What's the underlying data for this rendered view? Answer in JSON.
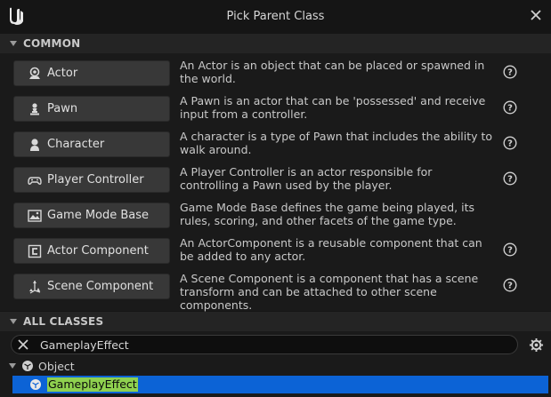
{
  "window": {
    "title": "Pick Parent Class"
  },
  "common": {
    "header": "COMMON",
    "items": [
      {
        "label": "Actor",
        "icon": "actor-icon",
        "desc": "An Actor is an object that can be placed or spawned in the world."
      },
      {
        "label": "Pawn",
        "icon": "pawn-icon",
        "desc": "A Pawn is an actor that can be 'possessed' and receive input from a controller."
      },
      {
        "label": "Character",
        "icon": "character-icon",
        "desc": "A character is a type of Pawn that includes the ability to walk around."
      },
      {
        "label": "Player Controller",
        "icon": "gamepad-icon",
        "desc": "A Player Controller is an actor responsible for controlling a Pawn used by the player."
      },
      {
        "label": "Game Mode Base",
        "icon": "game-mode-icon",
        "desc": "Game Mode Base defines the game being played, its rules, scoring, and other facets of the game type."
      },
      {
        "label": "Actor Component",
        "icon": "component-icon",
        "desc": "An ActorComponent is a reusable component that can be added to any actor."
      },
      {
        "label": "Scene Component",
        "icon": "scene-component-icon",
        "desc": "A Scene Component is a component that has a scene transform and can be attached to other scene components."
      }
    ]
  },
  "all_classes": {
    "header": "ALL CLASSES",
    "search_value": "GameplayEffect",
    "tree": {
      "root": "Object",
      "selected": "GameplayEffect"
    }
  },
  "colors": {
    "selection": "#0c63d6",
    "highlight": "#8fd14f"
  }
}
